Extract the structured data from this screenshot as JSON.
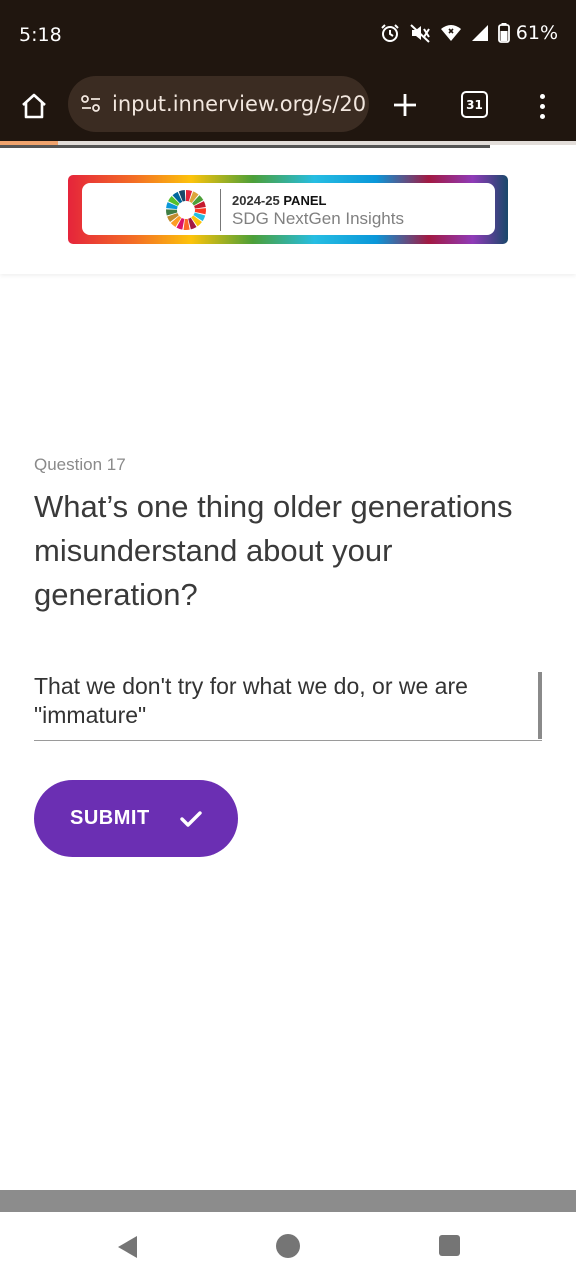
{
  "status_bar": {
    "time": "5:18",
    "battery_percent": "61%",
    "icons": [
      "alarm-icon",
      "mute-icon",
      "wifi-icon",
      "signal-icon",
      "battery-icon"
    ]
  },
  "browser": {
    "url": "input.innerview.org/s/20",
    "tab_count": "31",
    "icons": [
      "home-icon",
      "site-settings-icon",
      "new-tab-icon",
      "tabs-icon",
      "overflow-menu-icon"
    ]
  },
  "header": {
    "panel_year": "2024-25",
    "panel_label": "PANEL",
    "panel_title": "SDG NextGen Insights"
  },
  "question": {
    "number_label": "Question 17",
    "text": "What’s one thing older generations misunderstand about your generation?"
  },
  "answer": {
    "value": "That we don't try for what we do, or we are \"immature\""
  },
  "submit": {
    "label": "SUBMIT"
  },
  "colors": {
    "status_bar_bg": "#20160f",
    "url_pill_bg": "#3b2c22",
    "submit_bg": "#6b2fb3",
    "page_progress": "#f0a36d"
  },
  "navigation": {
    "icons": [
      "back-icon",
      "home-nav-icon",
      "recents-icon"
    ]
  }
}
